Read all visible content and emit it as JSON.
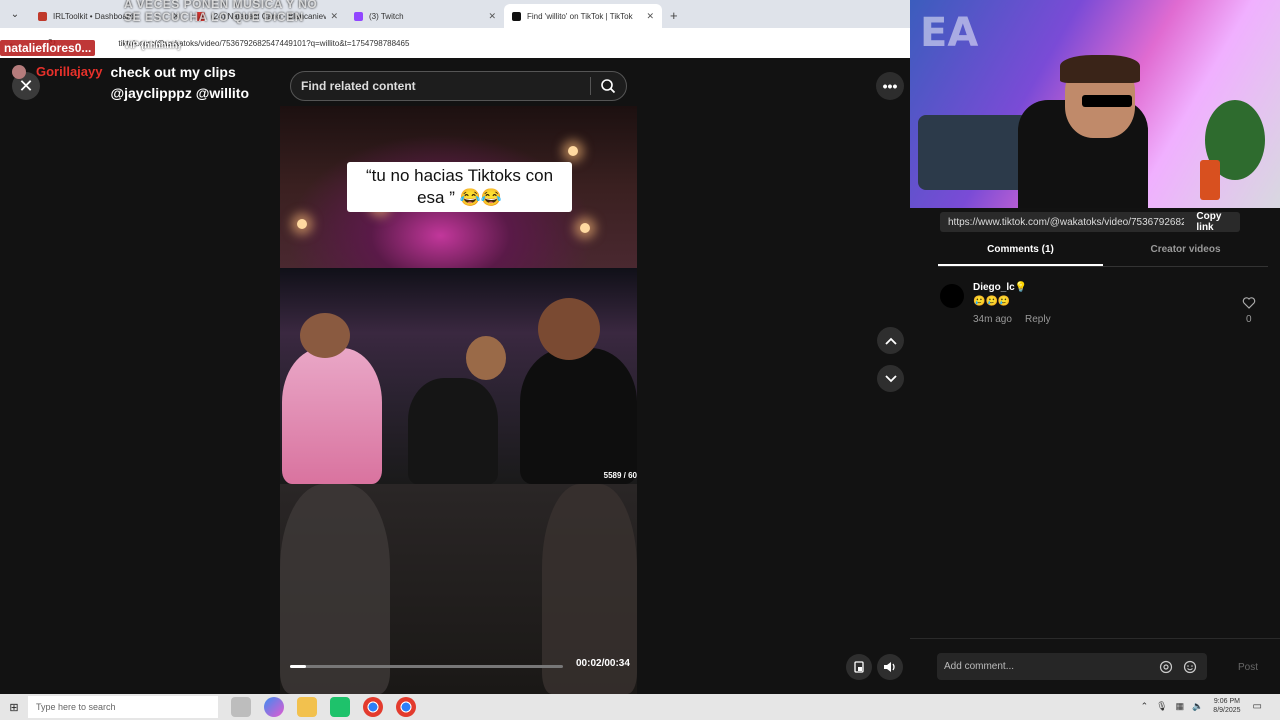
{
  "browser": {
    "tabs": [
      {
        "title": "IRLToolkit • Dashboard",
        "favicon_color": "#c0392b",
        "active": false
      },
      {
        "title": "(24) Natanael Cano - Blancanieves",
        "favicon_color": "#e53935",
        "active": false
      },
      {
        "title": "(3) Twitch",
        "favicon_color": "#9146ff",
        "active": false
      },
      {
        "title": "Find 'willito' on TikTok | TikTok",
        "favicon_color": "#111111",
        "active": true
      }
    ],
    "new_tab_label": "+",
    "url": "tiktok.com/@wakatoks/video/7536792682547449101?q=willito&t=1754798788465"
  },
  "overlay": {
    "top_text_line1": "A VECES PONEN MUSICA Y NO",
    "top_text_line2": "SE ESCUCHA LO QUE DICEN",
    "name_banner": "natalieflores0...",
    "vip_text": "VIP {hhhhhh}",
    "chat_user": "Gorillajayy",
    "chat_message": "check out my clips @jayclipppz @willito"
  },
  "tiktok": {
    "close_label": "✕",
    "more_label": "•••",
    "search_placeholder": "Find related content",
    "caption": "“tu no hacias Tiktoks con esa ” 😂😂",
    "counter": "5589 / 60",
    "progress": 0.06,
    "time": "00:02/00:34",
    "share_url": "https://www.tiktok.com/@wakatoks/video/7536792682...",
    "copy_link": "Copy link",
    "tabs": [
      "Comments (1)",
      "Creator videos"
    ],
    "comment": {
      "user": "Diego_lc💡",
      "emojis": "🥲🥲🥲",
      "time": "34m ago",
      "reply": "Reply",
      "likes": "0"
    },
    "comment_placeholder": "Add comment...",
    "post_label": "Post"
  },
  "taskbar": {
    "search_text": "Type here to search",
    "time": "9:06 PM",
    "date": "8/9/2025"
  }
}
